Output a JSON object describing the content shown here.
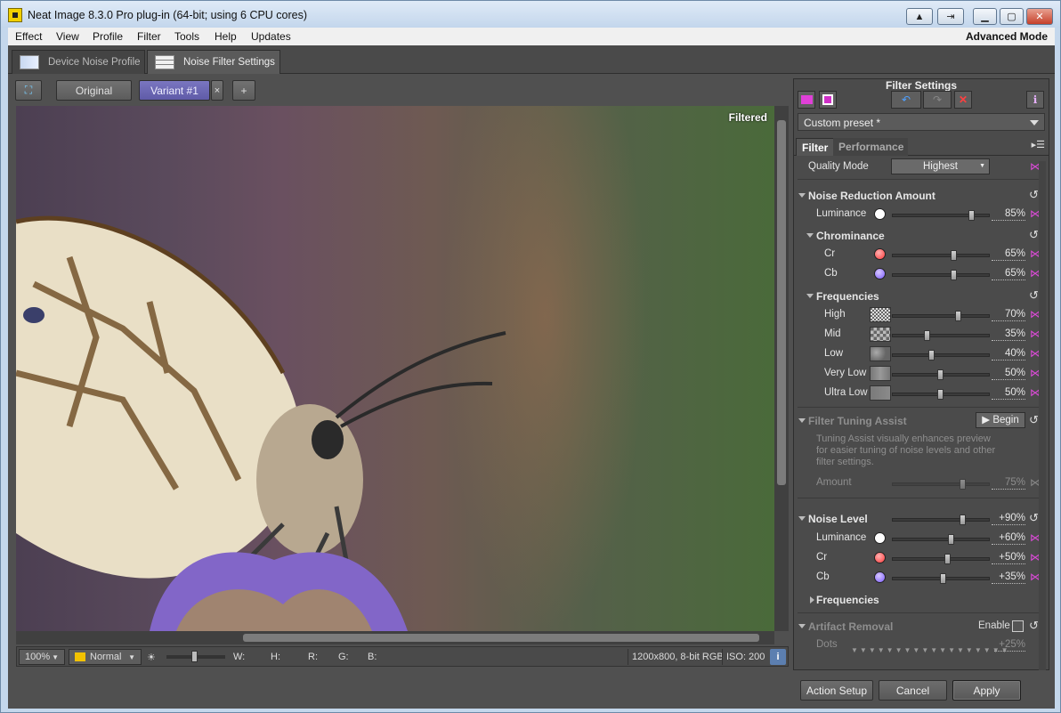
{
  "window": {
    "title": "Neat Image 8.3.0 Pro plug-in (64-bit; using 6 CPU cores)"
  },
  "menu": {
    "items": [
      "Effect",
      "View",
      "Profile",
      "Filter",
      "Tools",
      "Help",
      "Updates"
    ],
    "mode": "Advanced Mode"
  },
  "tabs": [
    {
      "label": "Device Noise Profile"
    },
    {
      "label": "Noise Filter Settings"
    }
  ],
  "viewbar": {
    "original": "Original",
    "variant": "Variant #1",
    "close": "×",
    "add": "+"
  },
  "preview": {
    "badge": "Filtered"
  },
  "status": {
    "zoom": "100%",
    "blend_mode": "Normal",
    "w": "W:",
    "h": "H:",
    "r": "R:",
    "g": "G:",
    "b": "B:",
    "image_info": "1200x800, 8-bit RGB",
    "iso": "ISO: 200"
  },
  "panel": {
    "title": "Filter Settings",
    "preset": "Custom preset *",
    "tabs": [
      "Filter",
      "Performance"
    ],
    "quality_mode": {
      "label": "Quality Mode",
      "value": "Highest"
    },
    "noise_reduction": {
      "title": "Noise Reduction Amount",
      "luminance": {
        "label": "Luminance",
        "value": "85%",
        "level": 0.85
      }
    },
    "chrominance": {
      "title": "Chrominance",
      "cr": {
        "label": "Cr",
        "value": "65%",
        "level": 0.65
      },
      "cb": {
        "label": "Cb",
        "value": "65%",
        "level": 0.65
      }
    },
    "frequencies": {
      "title": "Frequencies",
      "items": [
        {
          "label": "High",
          "value": "70%",
          "level": 0.7
        },
        {
          "label": "Mid",
          "value": "35%",
          "level": 0.35
        },
        {
          "label": "Low",
          "value": "40%",
          "level": 0.4
        },
        {
          "label": "Very Low",
          "value": "50%",
          "level": 0.5
        },
        {
          "label": "Ultra Low",
          "value": "50%",
          "level": 0.5
        }
      ]
    },
    "tuning": {
      "title": "Filter Tuning Assist",
      "button": "Begin",
      "description": "Tuning Assist visually enhances preview for easier tuning of noise levels and other filter settings.",
      "amount": {
        "label": "Amount",
        "value": "75%",
        "level": 0.75
      }
    },
    "noise_level": {
      "title": "Noise Level",
      "value": "+90%",
      "level": 0.75,
      "luminance": {
        "label": "Luminance",
        "value": "+60%",
        "level": 0.62
      },
      "cr": {
        "label": "Cr",
        "value": "+50%",
        "level": 0.58
      },
      "cb": {
        "label": "Cb",
        "value": "+35%",
        "level": 0.53
      },
      "frequencies": "Frequencies"
    },
    "artifact": {
      "title": "Artifact Removal",
      "enable": "Enable",
      "dots": {
        "label": "Dots",
        "value": "+25%"
      }
    }
  },
  "footer": {
    "action_setup": "Action Setup",
    "cancel": "Cancel",
    "apply": "Apply"
  },
  "colors": {
    "variant": "#6a66b4",
    "cr": "#ff4a4a",
    "cb": "#8a6aff",
    "link": "#e04adc"
  }
}
